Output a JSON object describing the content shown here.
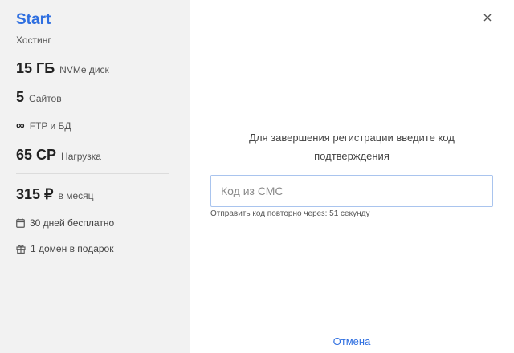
{
  "plan": {
    "name": "Start",
    "type": "Хостинг",
    "features": [
      {
        "value": "15 ГБ",
        "label": "NVMe диск"
      },
      {
        "value": "5",
        "label": "Сайтов"
      },
      {
        "value": "∞",
        "label": "FTP и БД"
      },
      {
        "value": "65 CP",
        "label": "Нагрузка"
      }
    ],
    "price": {
      "value": "315 ₽",
      "label": "в месяц"
    },
    "perks": [
      {
        "icon": "calendar-icon",
        "text": "30 дней бесплатно"
      },
      {
        "icon": "gift-icon",
        "text": "1 домен в подарок"
      }
    ]
  },
  "dialog": {
    "prompt": "Для завершения регистрации введите код подтверждения",
    "code_placeholder": "Код из СМС",
    "code_value": "",
    "resend_text": "Отправить код повторно через: 51 секунду",
    "cancel_label": "Отмена",
    "close_icon": "close-icon"
  },
  "colors": {
    "accent": "#2f6fe0",
    "sidebar_bg": "#f2f2f2",
    "input_border": "#a9c4ee"
  }
}
